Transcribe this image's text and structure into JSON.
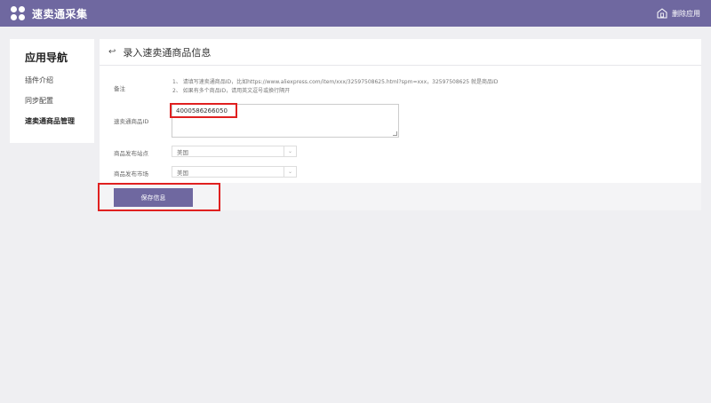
{
  "header": {
    "app_title": "速卖通采集",
    "remove_app_label": "删除应用"
  },
  "sidebar": {
    "title": "应用导航",
    "items": [
      {
        "label": "插件介绍"
      },
      {
        "label": "同步配置"
      },
      {
        "label": "速卖通商品管理"
      }
    ]
  },
  "main": {
    "back_icon": "↩",
    "title": "录入速卖通商品信息",
    "note": {
      "label": "备注",
      "line1": "1、 请填写速卖通商品ID，比如https://www.aliexpress.com/item/xxx/32597508625.html?spm=xxx，32597508625 就是商品ID",
      "line2": "2、 如果有多个商品ID，请用英文逗号或换行隔开"
    },
    "product_id": {
      "label": "速卖通商品ID",
      "value": "4000586266050"
    },
    "publish_site": {
      "label": "商品发布站点",
      "value": "美国"
    },
    "publish_market": {
      "label": "商品发布市场",
      "value": "美国"
    },
    "save_label": "保存信息"
  },
  "colors": {
    "accent": "#6f68a0",
    "highlight": "#e02020"
  }
}
